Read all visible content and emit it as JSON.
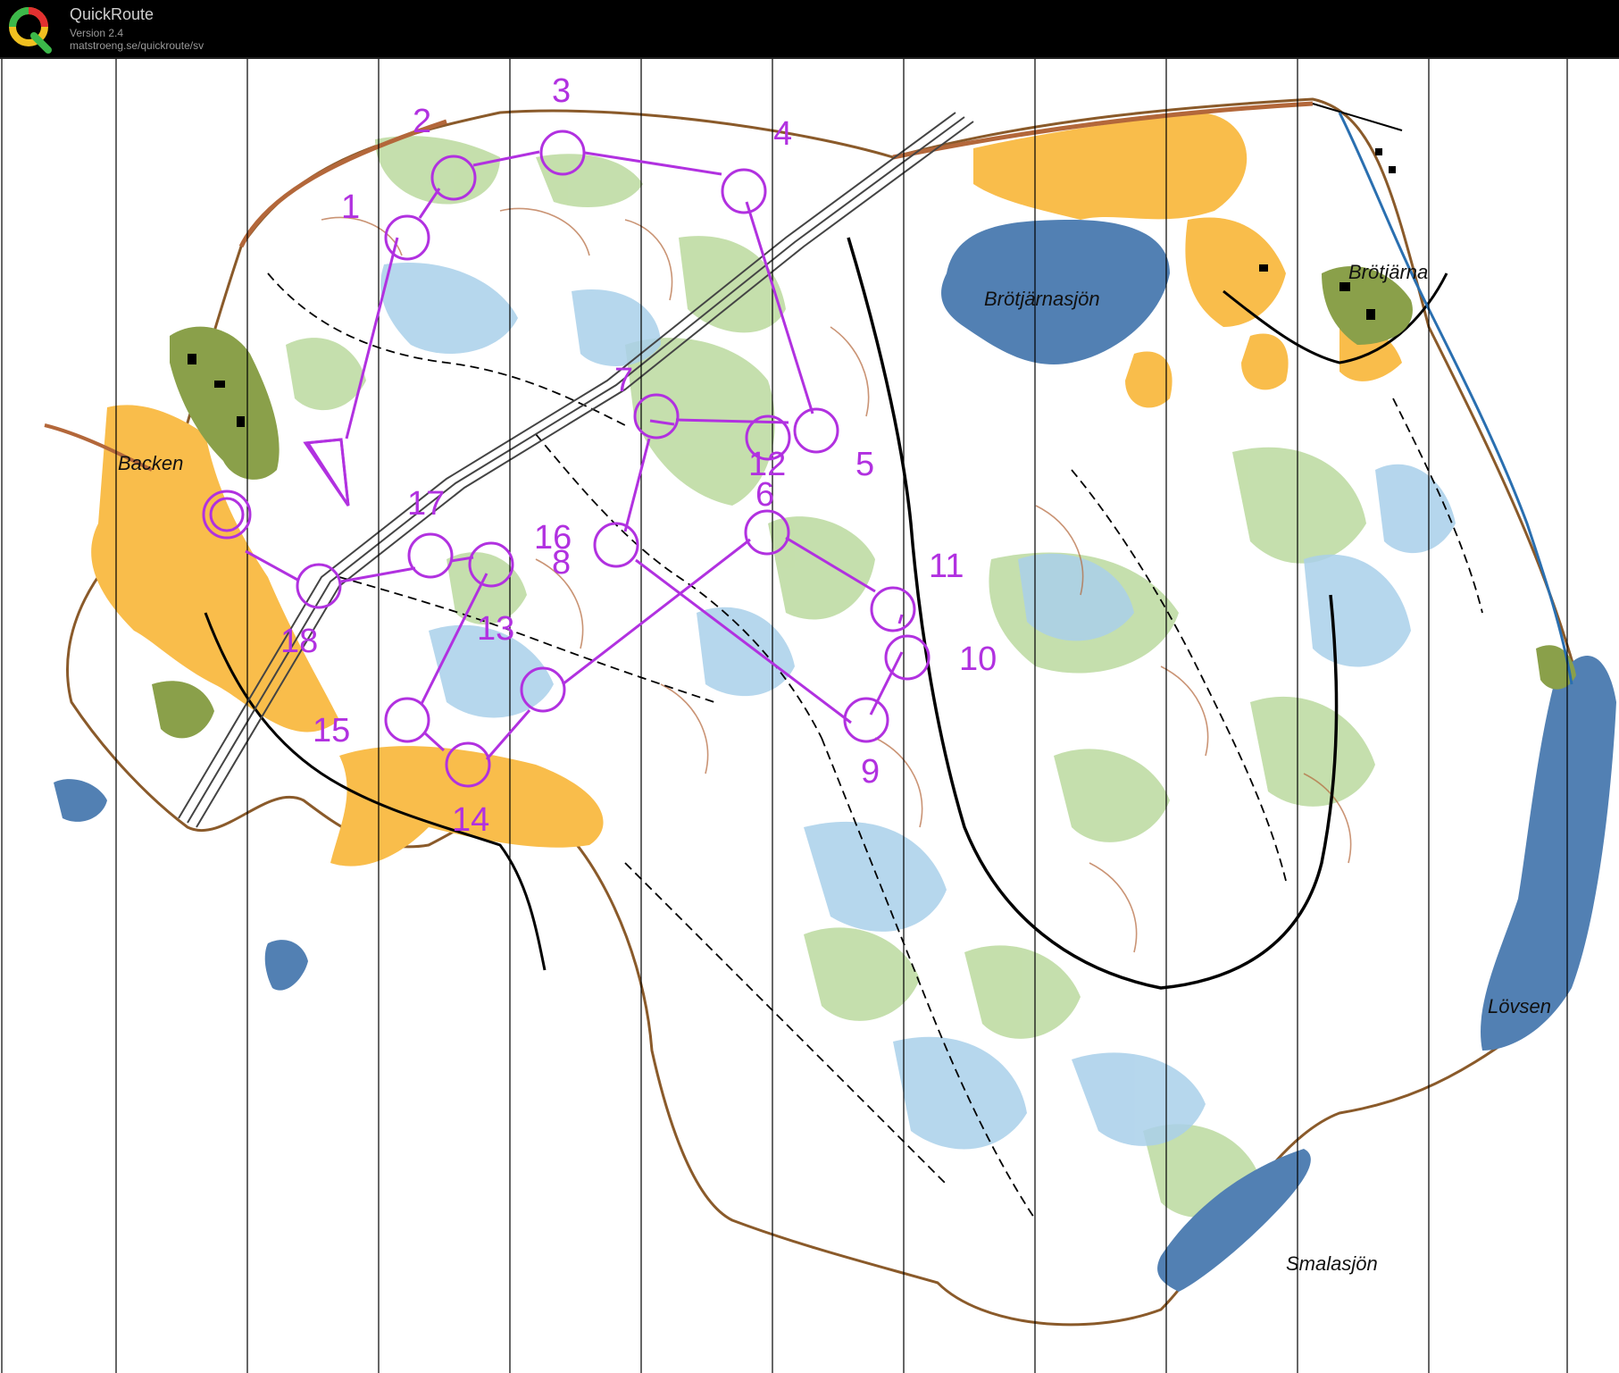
{
  "app": {
    "title": "QuickRoute",
    "version": "Version 2.4",
    "url": "matstroeng.se/quickroute/sv"
  },
  "colors": {
    "course": "#b131e0",
    "water": "#5280b3",
    "open_land": "#f9bd4b",
    "forest_green": "#bfdca4",
    "marsh": "#7ab5dc",
    "contour": "#b3673a"
  },
  "place_names": [
    {
      "key": "backen",
      "label": "Backen"
    },
    {
      "key": "brotjarna",
      "label": "Brötjärna"
    },
    {
      "key": "brotjarnasjon",
      "label": "Brötjärnasjön"
    },
    {
      "key": "lovsen",
      "label": "Lövsen"
    },
    {
      "key": "smalasjon",
      "label": "Smalasjön"
    }
  ],
  "course": {
    "controls": [
      "1",
      "2",
      "3",
      "4",
      "5",
      "6",
      "7",
      "8",
      "9",
      "10",
      "11",
      "12",
      "13",
      "14",
      "15",
      "16",
      "17",
      "18"
    ]
  }
}
